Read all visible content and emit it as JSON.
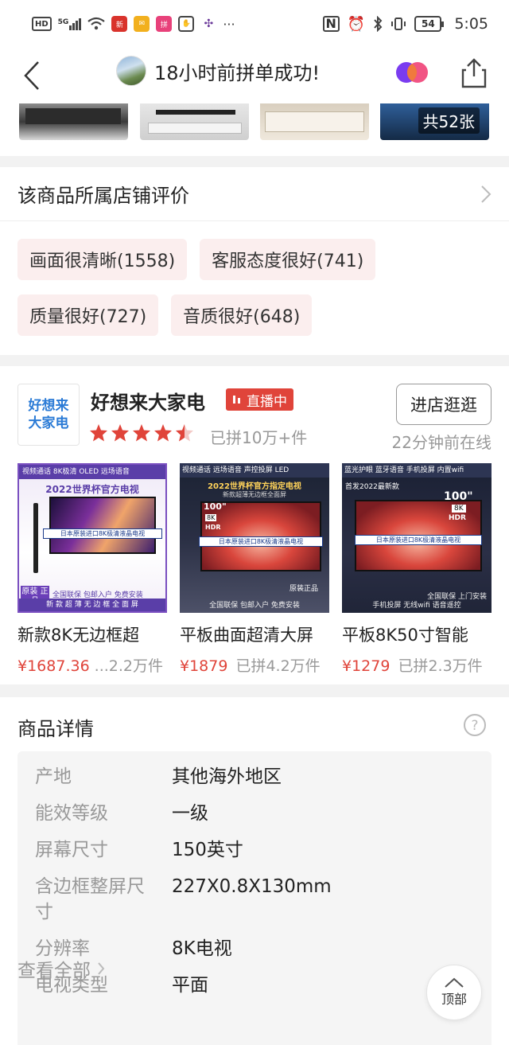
{
  "status_bar": {
    "network_hd": "HD",
    "network_5g": "5G",
    "time": "5:05",
    "battery": "54",
    "more": "···"
  },
  "nav": {
    "title": "18小时前拼单成功!"
  },
  "gallery": {
    "count_label": "共52张"
  },
  "reviews": {
    "title": "该商品所属店铺评价",
    "tags": [
      "画面很清晰(1558)",
      "客服态度很好(741)",
      "质量很好(727)",
      "音质很好(648)"
    ]
  },
  "store": {
    "logo_line1": "好想来",
    "logo_line2": "大家电",
    "name": "好想来大家电",
    "live_label": "直播中",
    "rating_stars": 4.5,
    "sold": "已拼10万+件",
    "visit_label": "进店逛逛",
    "online": "22分钟前在线",
    "products": [
      {
        "name": "新款8K无边框超",
        "price": "¥1687.36",
        "sold": "...2.2万件",
        "img_tags": "视频通话  8K极清  OLED  远场语音",
        "img_headline": "2022世界杯官方电视",
        "img_banner": "日本原装进口8K极清液晶电视",
        "img_corner": "原装 正品",
        "img_footer": "全国联保 包邮入户 免费安装",
        "img_footer2": "新 款 超 薄 无 边 框 全 面 屏"
      },
      {
        "name": "平板曲面超清大屏",
        "price": "¥1879",
        "sold": "已拼4.2万件",
        "img_tags": "视频通话  远场语音  声控投屏  LED",
        "img_headline": "2022世界杯官方指定电视",
        "img_sub": "新款超薄无边框全面屏",
        "img_size": "100\"",
        "img_res": "8K",
        "img_hdr": "HDR",
        "img_banner": "日本原装进口8K极清液晶电视",
        "img_corner": "原装正品",
        "img_footer": "全国联保 包邮入户 免费安装"
      },
      {
        "name": "平板8K50寸智能",
        "price": "¥1279",
        "sold": "已拼2.3万件",
        "img_tags": "蓝光护眼  蓝牙语音  手机投屏  内置wifi",
        "img_headline": "首发2022最新款",
        "img_size": "100\"",
        "img_res": "8K",
        "img_hdr": "HDR",
        "img_banner": "日本原装进口8K极清液晶电视",
        "img_footer": "全国联保  上门安装",
        "img_footer2": "手机投屏  无线wifi  语音遥控"
      }
    ]
  },
  "details": {
    "title": "商品详情",
    "specs": [
      {
        "key": "产地",
        "value": "其他海外地区"
      },
      {
        "key": "能效等级",
        "value": "一级"
      },
      {
        "key": "屏幕尺寸",
        "value": "150英寸"
      },
      {
        "key": "含边框整屏尺寸",
        "value": "227X0.8X130mm"
      },
      {
        "key": "分辨率",
        "value": "8K电视"
      },
      {
        "key": "电视类型",
        "value": "平面"
      }
    ],
    "view_all": "查看全部"
  },
  "back_to_top": "顶部",
  "colors": {
    "accent_red": "#e0443a",
    "tag_bg": "#fbeeee",
    "brand_blue": "#2b7bd6"
  }
}
